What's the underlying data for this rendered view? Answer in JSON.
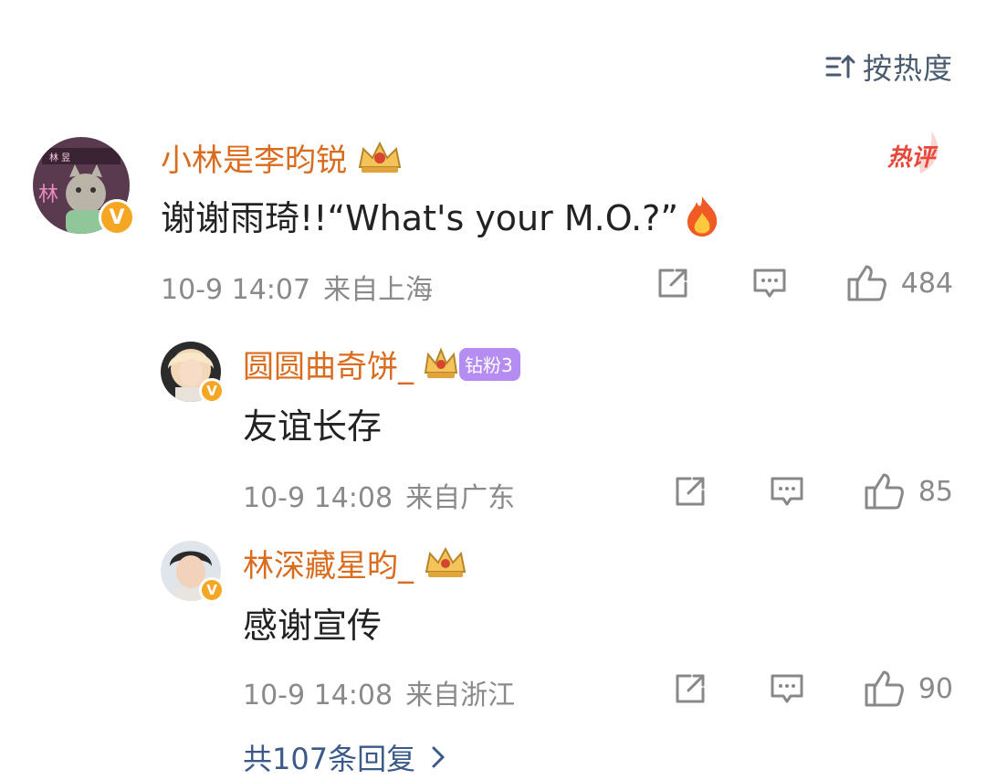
{
  "sort": {
    "label": "按热度",
    "icon": "sort-icon"
  },
  "comments": [
    {
      "username": "小林是李昀锐",
      "badge": "crown-icon",
      "hot_tag": "热评",
      "text": "谢谢雨琦!!“What's your M.O.?”",
      "emoji": "fire-icon",
      "date": "10-9 14:07",
      "location": "来自上海",
      "likes": "484"
    },
    {
      "username": "圆圆曲奇饼_",
      "badge": "crown-icon",
      "fan_badge": "钻粉3",
      "text": "友谊长存",
      "date": "10-9 14:08",
      "location": "来自广东",
      "likes": "85"
    },
    {
      "username": "林深藏星昀_",
      "badge": "crown-icon",
      "text": "感谢宣传",
      "date": "10-9 14:08",
      "location": "来自浙江",
      "likes": "90"
    }
  ],
  "more_replies": "共107条回复",
  "colors": {
    "name": "#d96c1f",
    "meta": "#8a8a8a",
    "link": "#3b5a8a",
    "hot": "#e8483a"
  }
}
